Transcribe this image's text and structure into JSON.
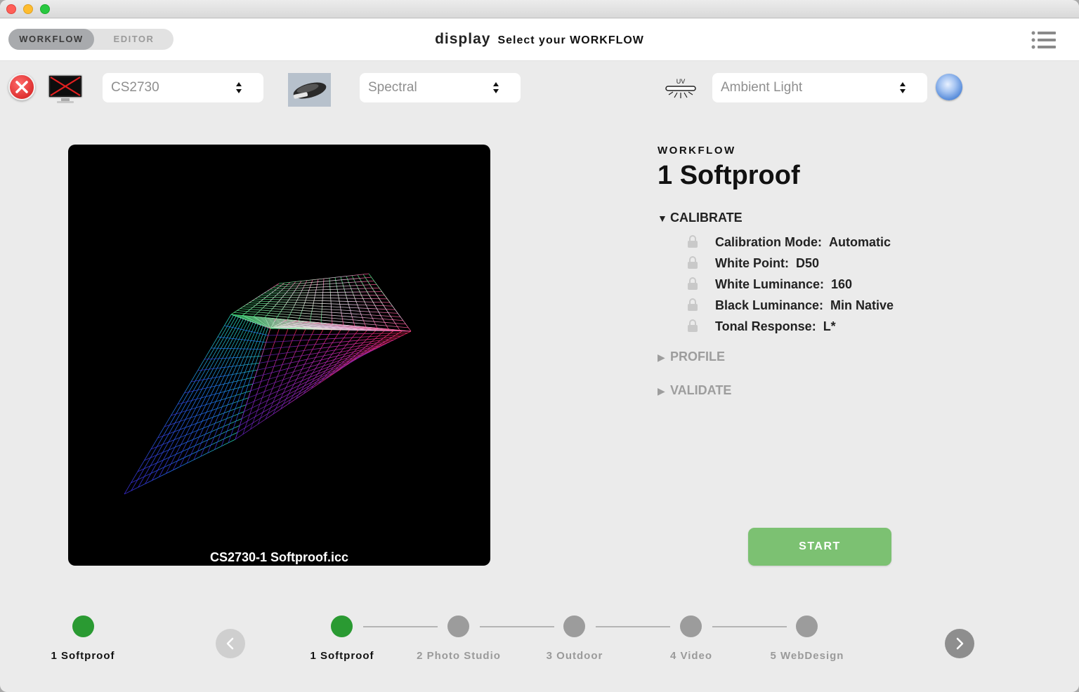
{
  "header": {
    "tabs": [
      {
        "label": "WORKFLOW",
        "active": true
      },
      {
        "label": "EDITOR",
        "active": false
      }
    ],
    "brand": "display",
    "subtitle": "Select your WORKFLOW",
    "menu_icon": "list-menu-icon"
  },
  "toolbar": {
    "status_icon": "error-close-icon",
    "monitor_icon": "monitor-disconnected-icon",
    "display_select": "CS2730",
    "device_icon": "colorimeter-device-icon",
    "mode_select": "Spectral",
    "uv_icon": "uv-filter-icon",
    "uv_text": "UV",
    "ambient_select": "Ambient Light",
    "sphere_icon": "ambient-sphere-icon"
  },
  "viewer": {
    "caption": "CS2730-1 Softproof.icc"
  },
  "panel": {
    "label": "WORKFLOW",
    "title": "1 Softproof",
    "calibrate": {
      "label": "CALIBRATE",
      "expanded": true,
      "rows": [
        {
          "key": "Calibration Mode:",
          "value": "Automatic"
        },
        {
          "key": "White Point:",
          "value": "D50"
        },
        {
          "key": "White Luminance:",
          "value": "160"
        },
        {
          "key": "Black Luminance:",
          "value": "Min Native"
        },
        {
          "key": "Tonal Response:",
          "value": "L*"
        }
      ]
    },
    "profile": {
      "label": "PROFILE",
      "expanded": false
    },
    "validate": {
      "label": "VALIDATE",
      "expanded": false
    },
    "start_label": "START"
  },
  "steps": {
    "current": "1 Softproof",
    "items": [
      {
        "label": "1 Softproof",
        "active": true
      },
      {
        "label": "2 Photo Studio",
        "active": false
      },
      {
        "label": "3 Outdoor",
        "active": false
      },
      {
        "label": "4 Video",
        "active": false
      },
      {
        "label": "5 WebDesign",
        "active": false
      }
    ]
  },
  "colors": {
    "accent_green": "#2a9a32",
    "start_green": "#7cc172",
    "inactive_grey": "#9c9c9c"
  }
}
